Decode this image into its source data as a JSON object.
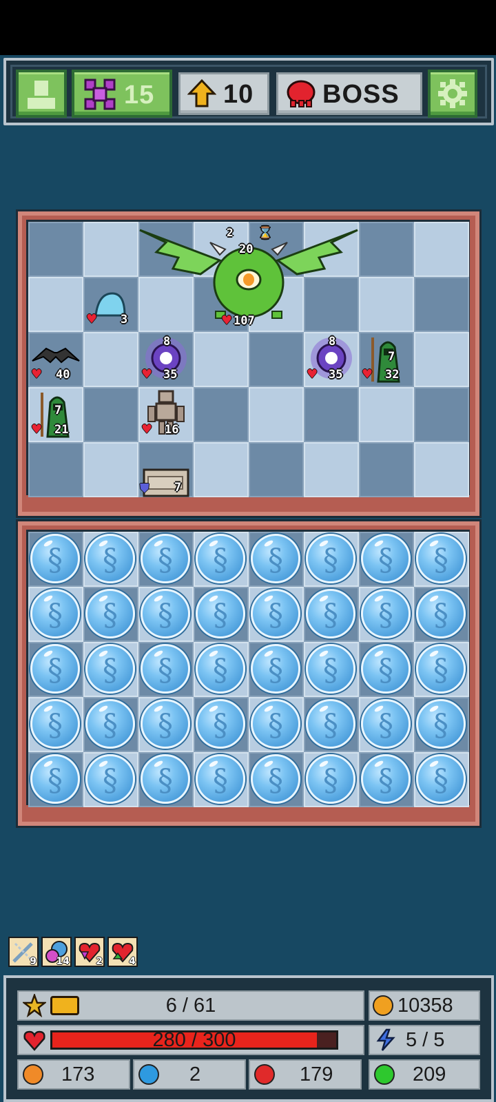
{
  "hud": {
    "profile_icon": "person-icon",
    "gems_count": "15",
    "level": "10",
    "stage_label": "BOSS",
    "settings_icon": "gear-icon"
  },
  "board": {
    "boss": {
      "name_icon": "winged-cyclops-boss",
      "attack": "2",
      "shield": "20",
      "hp": "107"
    },
    "units": [
      {
        "name": "slime",
        "hp": "3"
      },
      {
        "name": "bat",
        "hp": "40"
      },
      {
        "name": "skull-orb-left",
        "attack": "8",
        "hp": "35"
      },
      {
        "name": "skull-orb-right",
        "attack": "8",
        "hp": "35"
      },
      {
        "name": "green-mage-right",
        "attack": "7",
        "hp": "32"
      },
      {
        "name": "green-mage-left",
        "attack": "7",
        "hp": "21"
      },
      {
        "name": "stone-golem",
        "hp": "16"
      },
      {
        "name": "stone-chest",
        "armor": "7"
      }
    ]
  },
  "buffs": [
    {
      "icon": "sword-buff-icon",
      "count": "9"
    },
    {
      "icon": "orb-buff-icon",
      "count": "14"
    },
    {
      "icon": "heart-down-buff-icon",
      "count": "2"
    },
    {
      "icon": "heart-up-buff-icon",
      "count": "4"
    }
  ],
  "stats": {
    "xp": "6 / 61",
    "gold": "10358",
    "health": "280 / 300",
    "health_fraction": 0.933,
    "energy": "5 / 5",
    "orange_gems": "173",
    "blue_gems": "2",
    "red_gems": "179",
    "green_gems": "209"
  },
  "colors": {
    "background": "#174862",
    "panel": "#b55d52",
    "health_bar": "#e8241c"
  }
}
